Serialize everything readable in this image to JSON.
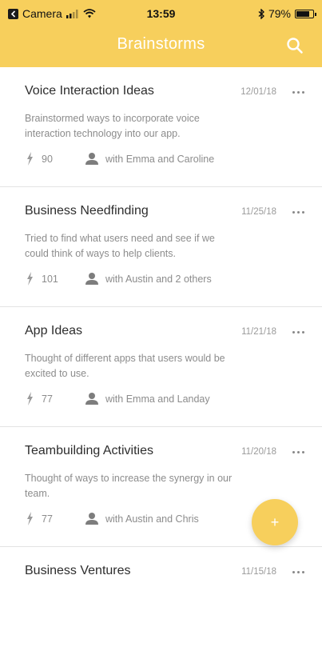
{
  "status_bar": {
    "carrier": "Camera",
    "time": "13:59",
    "bluetooth": "∗",
    "battery": "79%",
    "battery_level": 0.79
  },
  "header": {
    "title": "Brainstorms",
    "search_icon": "search-icon"
  },
  "cards": [
    {
      "title": "Voice Interaction Ideas",
      "date": "12/01/18",
      "description": "Brainstormed ways to incorporate voice interaction technology into our app.",
      "score": "90",
      "participants": "with Emma and Caroline"
    },
    {
      "title": "Business Needfinding",
      "date": "11/25/18",
      "description": "Tried to find what users need and see if we could think of ways to help clients.",
      "score": "101",
      "participants": "with Austin and 2 others"
    },
    {
      "title": "App Ideas",
      "date": "11/21/18",
      "description": "Thought of different apps that users would be excited to use.",
      "score": "77",
      "participants": "with Emma and Landay"
    },
    {
      "title": "Teambuilding Activities",
      "date": "11/20/18",
      "description": "Thought of ways to increase the synergy in our team.",
      "score": "77",
      "participants": "with Austin and Chris"
    },
    {
      "title": "Business Ventures",
      "date": "11/15/18",
      "description": "",
      "score": "",
      "participants": ""
    }
  ],
  "fab": {
    "label": "+"
  },
  "colors": {
    "accent": "#f7cf5c",
    "text_muted": "#8c8c8c"
  }
}
